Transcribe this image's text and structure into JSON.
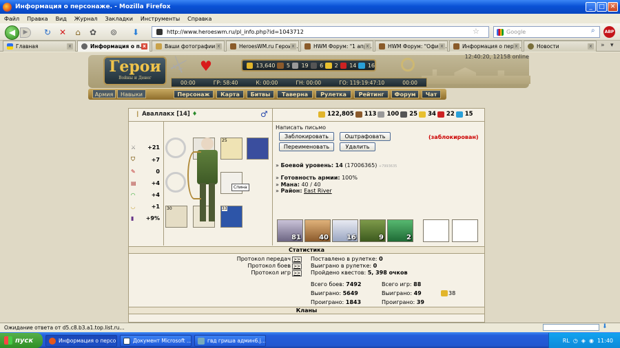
{
  "window": {
    "title": "Информация о персонаже. - Mozilla Firefox"
  },
  "menu": [
    "Файл",
    "Правка",
    "Вид",
    "Журнал",
    "Закладки",
    "Инструменты",
    "Справка"
  ],
  "browser": {
    "url": "http://www.heroeswm.ru/pl_info.php?id=1043712",
    "search_placeholder": "Google"
  },
  "tabs": [
    {
      "label": "Главная"
    },
    {
      "label": "Информация о п..."
    },
    {
      "label": "Ваши фотографии..."
    },
    {
      "label": "HeroesWM.ru Герои ..."
    },
    {
      "label": "HWM Форум: \"1 апр..."
    },
    {
      "label": "HWM Форум: \"Офиц..."
    },
    {
      "label": "Информация о перс..."
    },
    {
      "label": "Новости"
    }
  ],
  "game_header": {
    "logo_title": "Герои",
    "logo_subtitle": "Войны и Денег",
    "resources": [
      "13,640",
      "5",
      "19",
      "6",
      "2",
      "14",
      "16"
    ],
    "clock": "12:40:20, 12158 online",
    "timers": [
      {
        "label": "00:00"
      },
      {
        "label": "ГР: 58:40"
      },
      {
        "label": "К: 00:00"
      },
      {
        "label": "ГН: 00:00"
      },
      {
        "label": "ГО: 119:19:47:10"
      },
      {
        "label": "00:00"
      }
    ],
    "side_buttons": [
      "Армия",
      "Навыки"
    ],
    "nav": [
      "Персонаж",
      "Карта",
      "Битвы",
      "Таверна",
      "Рулетка",
      "Рейтинг",
      "Форум",
      "Чат"
    ]
  },
  "player": {
    "name": "Аваллакх",
    "level": "[14]",
    "gender_symbol": "♂",
    "resources": [
      "122,805",
      "113",
      "100",
      "25",
      "34",
      "22",
      "15"
    ],
    "stats": [
      {
        "icon": "attack-icon",
        "value": "+21"
      },
      {
        "icon": "defense-icon",
        "value": "+7"
      },
      {
        "icon": "spellpower-icon",
        "value": "0"
      },
      {
        "icon": "knowledge-icon",
        "value": "+4"
      },
      {
        "icon": "luck-icon",
        "value": "+4"
      },
      {
        "icon": "morale-icon",
        "value": "+1"
      },
      {
        "icon": "initiative-icon",
        "value": "+9%"
      }
    ],
    "slot_badges": {
      "amulet": "25",
      "weapon": "30",
      "shield": "33"
    },
    "tooltip": "Спина",
    "actions": {
      "write_letter": "Написать письмо",
      "block": "Заблокировать",
      "fine": "Оштрафовать",
      "rename": "Переименовать",
      "delete": "Удалить",
      "status": "(заблокирован)"
    },
    "info": {
      "combat_label": "Боевой уровень:",
      "combat_level": "14",
      "combat_exp": "(17006365)",
      "combat_extra": "+7993635",
      "army_label": "Готовность армии:",
      "army_value": "100%",
      "mana_label": "Мана:",
      "mana_value": "40 / 40",
      "district_label": "Район:",
      "district_value": "East River"
    },
    "army": [
      "81",
      "40",
      "16",
      "9",
      "2",
      "",
      ""
    ]
  },
  "statistics": {
    "title": "Статистика",
    "protocols": [
      "Протокол передач",
      "Протокол боев",
      "Протокол игр"
    ],
    "protocol_link": ">>",
    "roulette": [
      {
        "label": "Поставлено в рулетке:",
        "value": "0"
      },
      {
        "label": "Выиграно в рулетке:",
        "value": "0"
      },
      {
        "label": "Пройдено квестов:",
        "value": "5, 398 очков"
      }
    ],
    "battles": [
      {
        "label": "Всего боев:",
        "value": "7492"
      },
      {
        "label": "Выиграно:",
        "value": "5649"
      },
      {
        "label": "Проиграно:",
        "value": "1843"
      }
    ],
    "games": [
      {
        "label": "Всего игр:",
        "value": "88"
      },
      {
        "label": "Выиграно:",
        "value": "49"
      },
      {
        "label": "Проиграно:",
        "value": "39"
      }
    ],
    "gold_bonus": "38",
    "clans_title": "Кланы"
  },
  "statusbar": {
    "text": "Ожидание ответа от d5.c8.b3.a1.top.list.ru..."
  },
  "taskbar": {
    "start": "пуск",
    "tasks": [
      "Информация о персо...",
      "Документ Microsoft ...",
      "гвд гриша админ6.j..."
    ],
    "lang": "RL",
    "time": "11:40"
  },
  "colors": {
    "accent": "#b49654",
    "blocked": "#cc0000",
    "taskbar": "#245edb"
  }
}
